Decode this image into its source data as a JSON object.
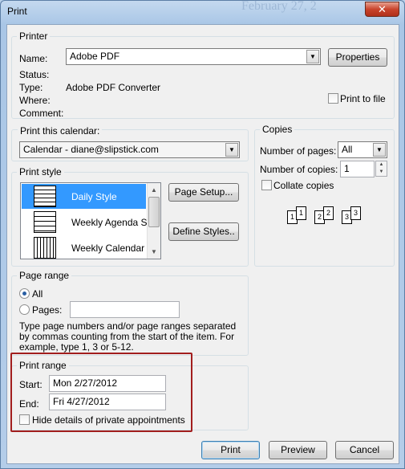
{
  "window": {
    "title": "Print",
    "bg_title": "February 27, 2",
    "close": "✕"
  },
  "printer": {
    "group_title": "Printer",
    "name_label": "Name:",
    "name_value": "Adobe PDF",
    "properties_label": "Properties",
    "status_label": "Status:",
    "type_label": "Type:",
    "type_value": "Adobe PDF Converter",
    "where_label": "Where:",
    "comment_label": "Comment:",
    "print_to_file_label": "Print to file"
  },
  "print_calendar": {
    "label": "Print this calendar:",
    "value": "Calendar - diane@slipstick.com"
  },
  "print_style": {
    "group_title": "Print style",
    "items": [
      "Daily Style",
      "Weekly Agenda Style",
      "Weekly Calendar Style"
    ],
    "page_setup_label": "Page Setup...",
    "define_styles_label": "Define Styles.."
  },
  "copies": {
    "group_title": "Copies",
    "num_pages_label": "Number of pages:",
    "num_pages_value": "All",
    "num_copies_label": "Number of copies:",
    "num_copies_value": "1",
    "collate_label": "Collate copies",
    "collate_pages": [
      "1",
      "1",
      "2",
      "2",
      "3",
      "3"
    ]
  },
  "page_range": {
    "group_title": "Page range",
    "all_label": "All",
    "pages_label": "Pages:",
    "help_text": "Type page numbers and/or page ranges separated by commas counting from the start of the item.  For example, type 1, 3 or 5-12."
  },
  "print_range": {
    "group_title": "Print range",
    "start_label": "Start:",
    "start_value": "Mon 2/27/2012",
    "end_label": "End:",
    "end_value": "Fri 4/27/2012",
    "hide_details_label": "Hide details of private appointments"
  },
  "footer": {
    "print_label": "Print",
    "preview_label": "Preview",
    "cancel_label": "Cancel"
  },
  "colors": {
    "selection": "#3399ff",
    "highlight": "#a21e1e",
    "title_bg": "#b9d1ea"
  }
}
